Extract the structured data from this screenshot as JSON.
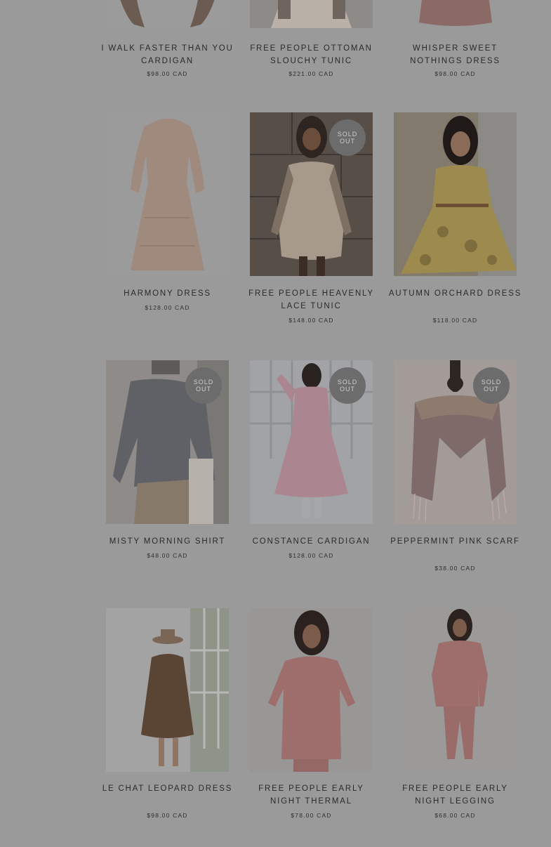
{
  "products": [
    {
      "title": "I WALK FASTER THAN YOU CARDIGAN",
      "price": "$98.00 CAD",
      "sold_out": false,
      "image_desc": "cardigan-photo"
    },
    {
      "title": "FREE PEOPLE OTTOMAN SLOUCHY TUNIC",
      "price": "$221.00 CAD",
      "sold_out": false,
      "image_desc": "tunic-photo"
    },
    {
      "title": "WHISPER SWEET NOTHINGS DRESS",
      "price": "$98.00 CAD",
      "sold_out": false,
      "image_desc": "dress-photo"
    },
    {
      "title": "HARMONY DRESS",
      "price": "$128.00 CAD",
      "sold_out": false,
      "image_desc": "beige-dress-photo"
    },
    {
      "title": "FREE PEOPLE HEAVENLY LACE TUNIC",
      "price": "$148.00 CAD",
      "sold_out": true,
      "image_desc": "lace-tunic-photo"
    },
    {
      "title": "AUTUMN ORCHARD DRESS",
      "price": "$118.00 CAD",
      "sold_out": false,
      "image_desc": "yellow-floral-dress-photo"
    },
    {
      "title": "MISTY MORNING SHIRT",
      "price": "$48.00 CAD",
      "sold_out": true,
      "image_desc": "grey-shirt-photo"
    },
    {
      "title": "CONSTANCE CARDIGAN",
      "price": "$128.00 CAD",
      "sold_out": true,
      "image_desc": "pink-cardigan-photo"
    },
    {
      "title": "PEPPERMINT PINK SCARF",
      "price": "$38.00 CAD",
      "sold_out": true,
      "image_desc": "pink-scarf-photo"
    },
    {
      "title": "LE CHAT LEOPARD DRESS",
      "price": "$98.00 CAD",
      "sold_out": false,
      "image_desc": "leopard-dress-photo"
    },
    {
      "title": "FREE PEOPLE EARLY NIGHT THERMAL",
      "price": "$78.00 CAD",
      "sold_out": false,
      "image_desc": "pink-thermal-photo"
    },
    {
      "title": "FREE PEOPLE EARLY NIGHT LEGGING",
      "price": "$68.00 CAD",
      "sold_out": false,
      "image_desc": "pink-legging-photo"
    }
  ],
  "sold_out_label_line1": "SOLD",
  "sold_out_label_line2": "OUT",
  "colors": {
    "background": "#9a9a9a",
    "text": "#2a2a2a",
    "badge": "#6c6c6c"
  }
}
